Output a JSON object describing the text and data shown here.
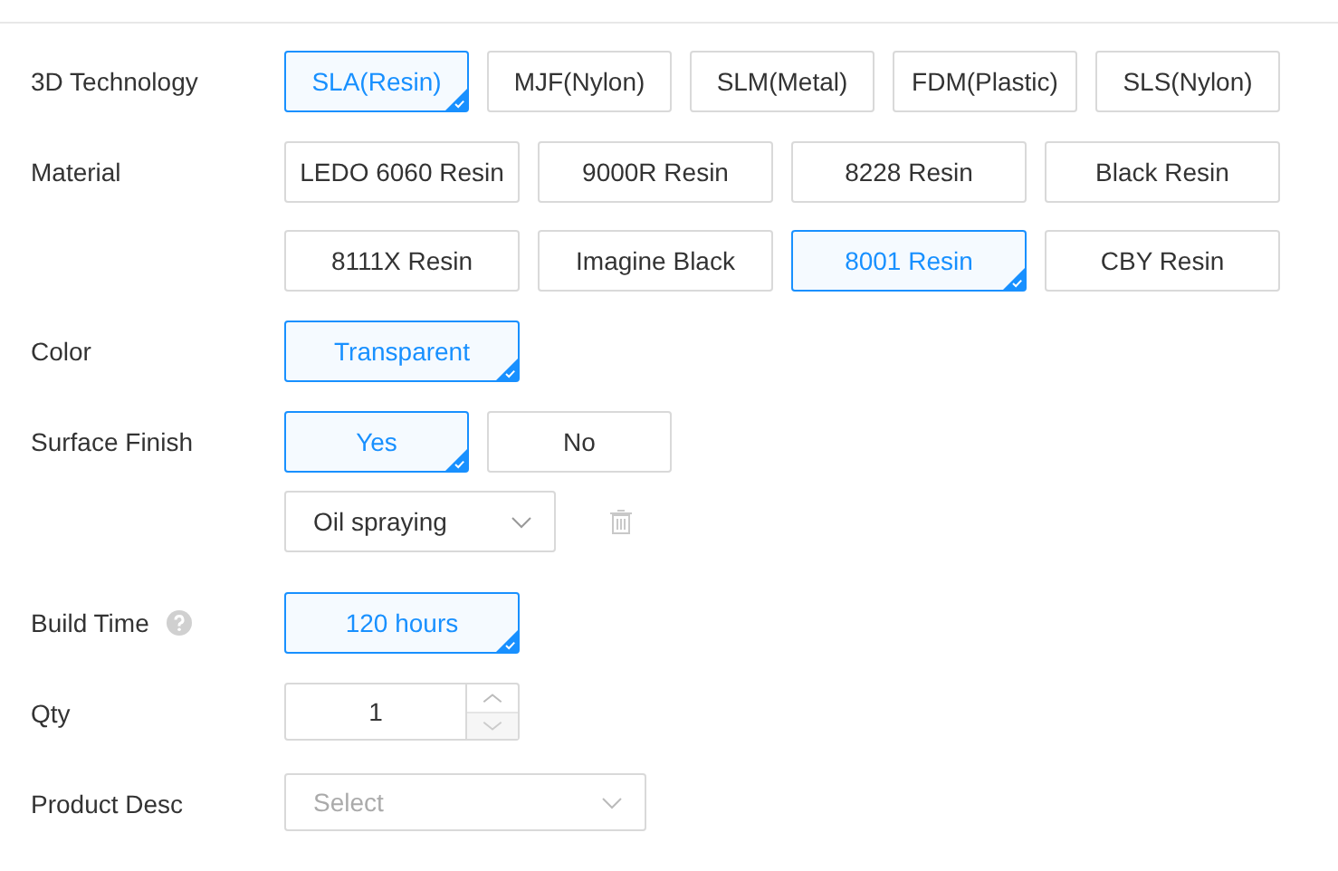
{
  "fields": [
    {
      "label": "3D Technology",
      "kind": "chips",
      "options": [
        {
          "label": "SLA(Resin)",
          "selected": true
        },
        {
          "label": "MJF(Nylon)",
          "selected": false
        },
        {
          "label": "SLM(Metal)",
          "selected": false
        },
        {
          "label": "FDM(Plastic)",
          "selected": false
        },
        {
          "label": "SLS(Nylon)",
          "selected": false
        }
      ]
    },
    {
      "label": "Material",
      "kind": "tiles",
      "options": [
        {
          "label": "LEDO 6060 Resin",
          "selected": false
        },
        {
          "label": "9000R Resin",
          "selected": false
        },
        {
          "label": "8228 Resin",
          "selected": false
        },
        {
          "label": "Black Resin",
          "selected": false
        },
        {
          "label": "8111X Resin",
          "selected": false
        },
        {
          "label": "Imagine Black",
          "selected": false
        },
        {
          "label": "8001 Resin",
          "selected": true
        },
        {
          "label": "CBY Resin",
          "selected": false
        }
      ]
    },
    {
      "label": "Color",
      "kind": "tiles",
      "options": [
        {
          "label": "Transparent",
          "selected": true
        }
      ]
    },
    {
      "label": "Surface Finish",
      "kind": "chips",
      "options": [
        {
          "label": "Yes",
          "selected": true
        },
        {
          "label": "No",
          "selected": false
        }
      ],
      "select": {
        "value": "Oil spraying"
      }
    },
    {
      "label": "Build Time",
      "kind": "tiles",
      "help": true,
      "options": [
        {
          "label": "120 hours",
          "selected": true
        }
      ]
    },
    {
      "label": "Qty",
      "kind": "number",
      "value": "1"
    },
    {
      "label": "Product Desc",
      "kind": "select",
      "placeholder": "Select"
    }
  ]
}
